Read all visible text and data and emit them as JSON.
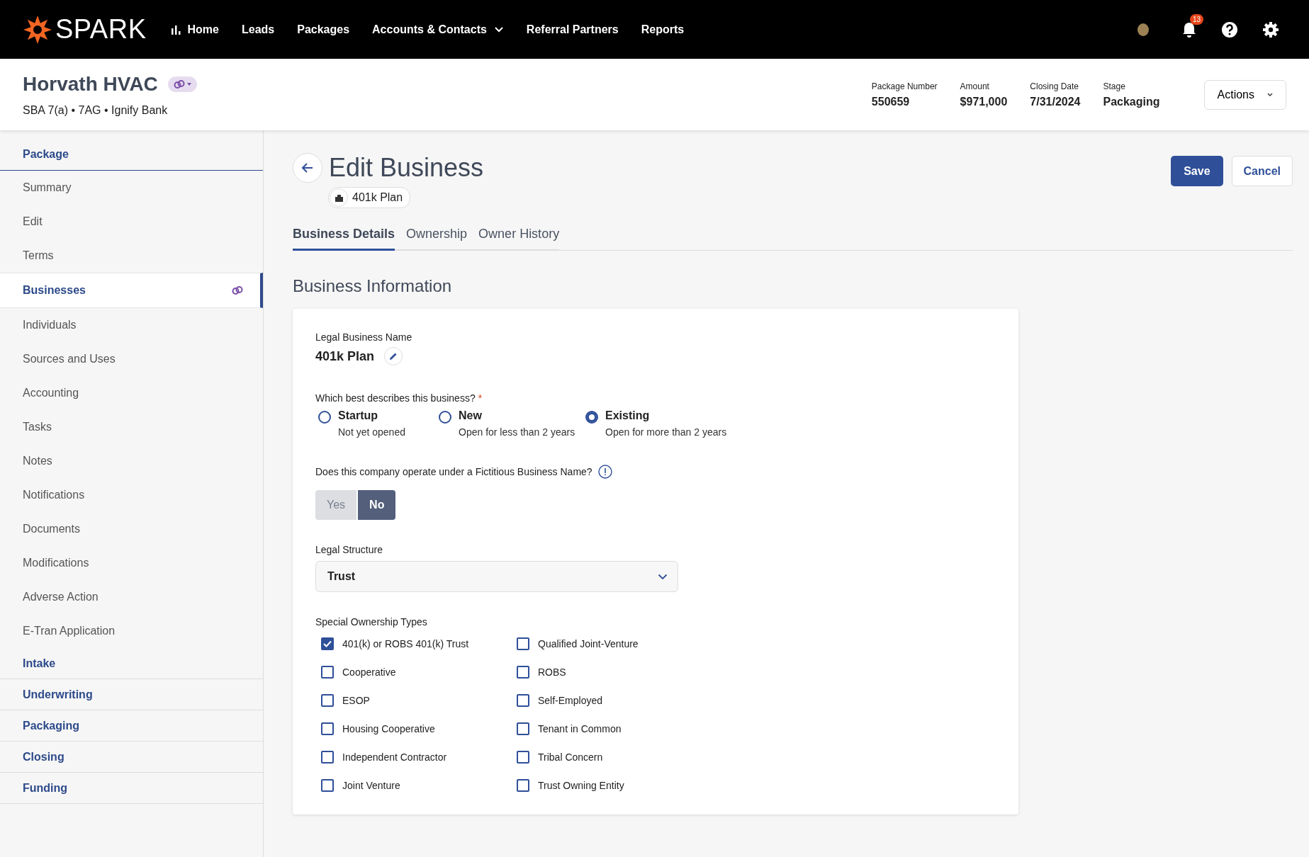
{
  "top_nav": {
    "logo": "SPARK",
    "items": [
      {
        "label": "Home",
        "icon": true,
        "dropdown": false
      },
      {
        "label": "Leads",
        "icon": false,
        "dropdown": false
      },
      {
        "label": "Packages",
        "icon": false,
        "dropdown": false
      },
      {
        "label": "Accounts & Contacts",
        "icon": false,
        "dropdown": true
      },
      {
        "label": "Referral Partners",
        "icon": false,
        "dropdown": false
      },
      {
        "label": "Reports",
        "icon": false,
        "dropdown": false
      }
    ],
    "notification_count": "13"
  },
  "header": {
    "title": "Horvath HVAC",
    "subtitle": "SBA 7(a) • 7AG • Ignify Bank",
    "stats": [
      {
        "label": "Package Number",
        "value": "550659"
      },
      {
        "label": "Amount",
        "value": "$971,000"
      },
      {
        "label": "Closing Date",
        "value": "7/31/2024"
      },
      {
        "label": "Stage",
        "value": "Packaging"
      }
    ],
    "actions": "Actions"
  },
  "sidebar": {
    "sections": [
      {
        "title": "Package",
        "items": [
          {
            "label": "Summary",
            "selected": false,
            "linked": false
          },
          {
            "label": "Edit",
            "selected": false,
            "linked": false
          },
          {
            "label": "Terms",
            "selected": false,
            "linked": false
          },
          {
            "label": "Businesses",
            "selected": true,
            "linked": true
          },
          {
            "label": "Individuals",
            "selected": false,
            "linked": false
          },
          {
            "label": "Sources and Uses",
            "selected": false,
            "linked": false
          },
          {
            "label": "Accounting",
            "selected": false,
            "linked": false
          },
          {
            "label": "Tasks",
            "selected": false,
            "linked": false
          },
          {
            "label": "Notes",
            "selected": false,
            "linked": false
          },
          {
            "label": "Notifications",
            "selected": false,
            "linked": false
          },
          {
            "label": "Documents",
            "selected": false,
            "linked": false
          },
          {
            "label": "Modifications",
            "selected": false,
            "linked": false
          },
          {
            "label": "Adverse Action",
            "selected": false,
            "linked": false
          },
          {
            "label": "E-Tran Application",
            "selected": false,
            "linked": false
          }
        ]
      },
      {
        "title": "Intake"
      },
      {
        "title": "Underwriting"
      },
      {
        "title": "Packaging"
      },
      {
        "title": "Closing"
      },
      {
        "title": "Funding"
      }
    ]
  },
  "page": {
    "title": "Edit Business",
    "chip": "401k Plan",
    "buttons": {
      "save": "Save",
      "cancel": "Cancel"
    },
    "tabs": [
      {
        "label": "Business Details",
        "selected": true
      },
      {
        "label": "Ownership",
        "selected": false
      },
      {
        "label": "Owner History",
        "selected": false
      }
    ],
    "section_title": "Business Information",
    "form": {
      "name_label": "Legal Business Name",
      "name_value": "401k Plan",
      "type_question": "Which best describes this business?",
      "required_mark": "*",
      "type_options": [
        {
          "label": "Startup",
          "hint": "Not yet opened",
          "selected": false
        },
        {
          "label": "New",
          "hint": "Open for less than 2 years",
          "selected": false
        },
        {
          "label": "Existing",
          "hint": "Open for more than 2 years",
          "selected": true
        }
      ],
      "fictitious_question": "Does this company operate under a Fictitious Business Name?",
      "fictitious_options": [
        {
          "label": "Yes",
          "selected": false
        },
        {
          "label": "No",
          "selected": true
        }
      ],
      "structure_label": "Legal Structure",
      "structure_value": "Trust",
      "ownership_label": "Special Ownership Types",
      "ownership_types": [
        {
          "label": "401(k) or ROBS 401(k) Trust",
          "checked": true
        },
        {
          "label": "Cooperative",
          "checked": false
        },
        {
          "label": "ESOP",
          "checked": false
        },
        {
          "label": "Housing Cooperative",
          "checked": false
        },
        {
          "label": "Independent Contractor",
          "checked": false
        },
        {
          "label": "Joint Venture",
          "checked": false
        },
        {
          "label": "Qualified Joint-Venture",
          "checked": false
        },
        {
          "label": "ROBS",
          "checked": false
        },
        {
          "label": "Self-Employed",
          "checked": false
        },
        {
          "label": "Tenant in Common",
          "checked": false
        },
        {
          "label": "Tribal Concern",
          "checked": false
        },
        {
          "label": "Trust Owning Entity",
          "checked": false
        }
      ]
    }
  }
}
